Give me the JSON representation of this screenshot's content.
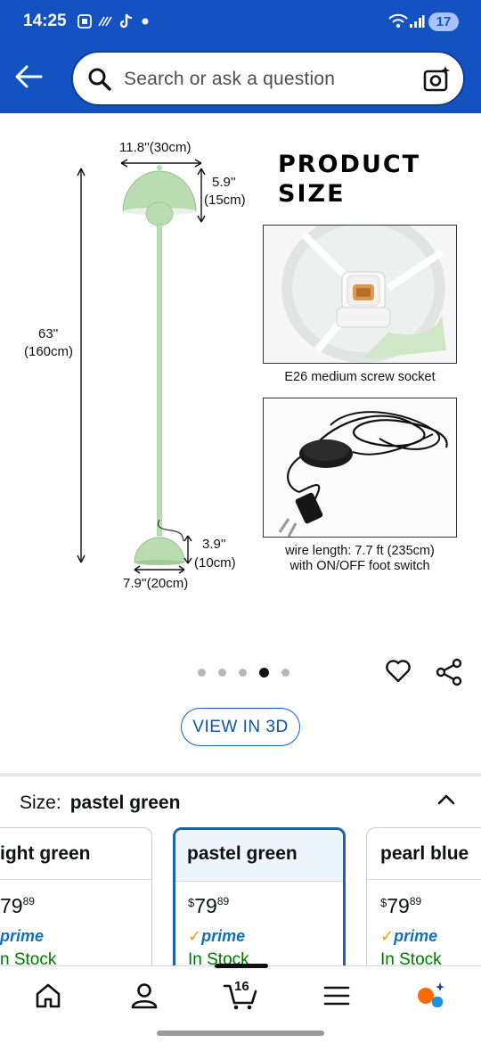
{
  "status_bar": {
    "time": "14:25",
    "battery": "17"
  },
  "search": {
    "placeholder": "Search or ask a question"
  },
  "product_image": {
    "dimensions": {
      "shade_width": "11.8''(30cm)",
      "shade_height_line1": "5.9''",
      "shade_height_line2": "(15cm)",
      "total_height_line1": "63''",
      "total_height_line2": "(160cm)",
      "base_height_line1": "3.9''",
      "base_height_line2": "(10cm)",
      "base_width": "7.9''(20cm)"
    },
    "title_line1": "PRODUCT",
    "title_line2": "SIZE",
    "socket_caption": "E26 medium screw socket",
    "wire_caption_line1": "wire length: 7.7 ft (235cm)",
    "wire_caption_line2": "with ON/OFF foot switch",
    "lamp_color": "#b9ddb0"
  },
  "carousel": {
    "dot_count": 5,
    "active_index": 3
  },
  "view_3d_label": "VIEW IN 3D",
  "size_selector": {
    "label": "Size:",
    "selected": "pastel green",
    "options": [
      {
        "name": "light green",
        "visible_name": "ight green",
        "price_currency": "$",
        "price_whole": "79",
        "price_fraction": "89",
        "prime": "prime",
        "stock": "In Stock",
        "visible_stock": "n Stock",
        "visible_prime": "prime",
        "visible_price_whole": "79"
      },
      {
        "name": "pastel green",
        "price_currency": "$",
        "price_whole": "79",
        "price_fraction": "89",
        "prime": "prime",
        "stock": "In Stock"
      },
      {
        "name": "pearl blue",
        "price_currency": "$",
        "price_whole": "79",
        "price_fraction": "89",
        "prime": "prime",
        "stock": "In Stock"
      }
    ]
  },
  "bottom_nav": {
    "cart_count": "16",
    "items": [
      "home-icon",
      "account-icon",
      "cart-icon",
      "menu-icon",
      "rufus-icon"
    ]
  },
  "colors": {
    "header_blue": "#1452c2",
    "link_blue": "#0b57a4",
    "in_stock_green": "#007600",
    "prime_blue": "#0e6fc1",
    "prime_check_orange": "#ff9900"
  }
}
